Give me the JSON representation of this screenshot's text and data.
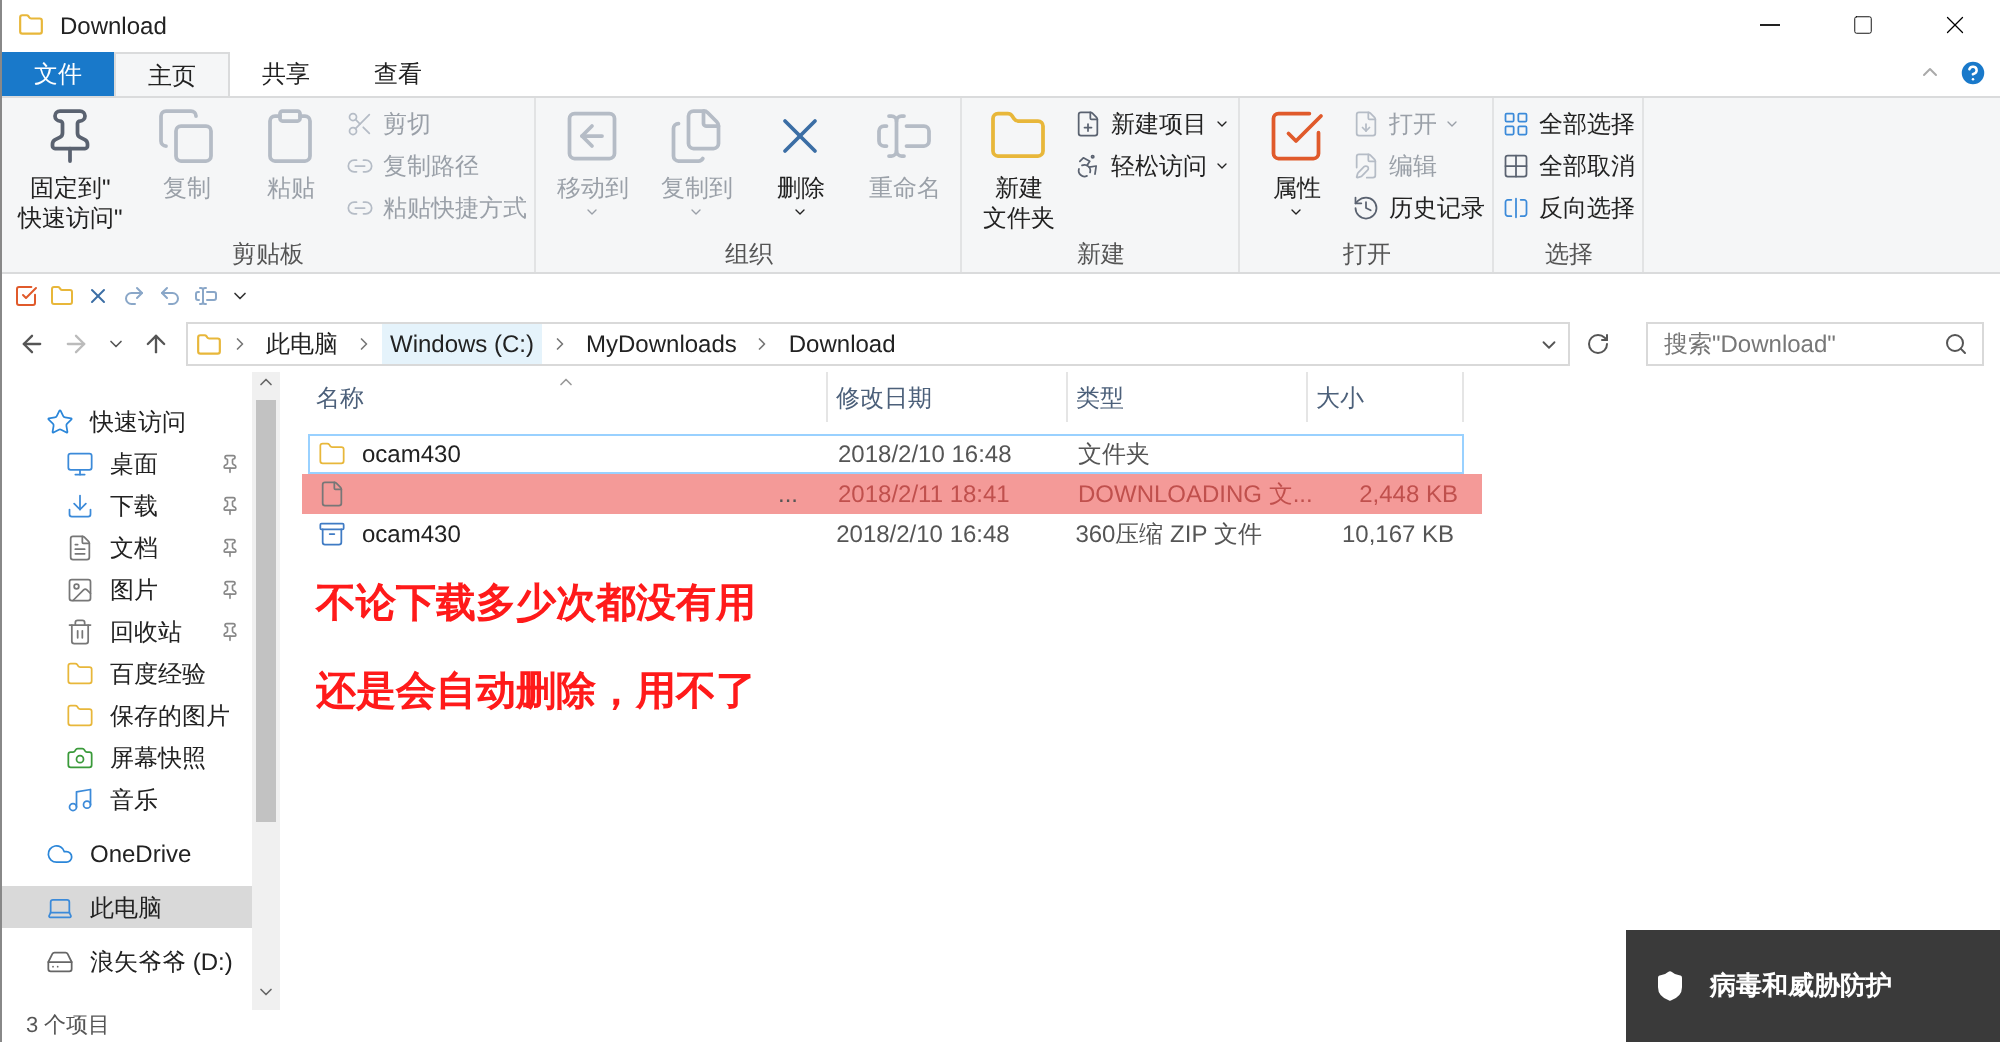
{
  "window": {
    "title": "Download"
  },
  "ribbon_tabs": [
    {
      "label": "文件",
      "kind": "file",
      "selected": false
    },
    {
      "label": "主页",
      "kind": "tab",
      "selected": true
    },
    {
      "label": "共享",
      "kind": "tab",
      "selected": false
    },
    {
      "label": "查看",
      "kind": "tab",
      "selected": false
    }
  ],
  "ribbon_groups": [
    {
      "label": "剪贴板",
      "items": [
        {
          "kind": "large",
          "lines": [
            "固定到\"",
            "快速访问\""
          ],
          "disabled": false,
          "dropdown": false
        },
        {
          "kind": "large",
          "lines": [
            "复制"
          ],
          "disabled": true,
          "dropdown": false
        },
        {
          "kind": "large",
          "lines": [
            "粘贴"
          ],
          "disabled": true,
          "dropdown": false
        },
        {
          "kind": "stack",
          "items": [
            {
              "label": "剪切",
              "disabled": true,
              "dropdown": false
            },
            {
              "label": "复制路径",
              "disabled": true,
              "dropdown": false
            },
            {
              "label": "粘贴快捷方式",
              "disabled": true,
              "dropdown": false
            }
          ]
        }
      ]
    },
    {
      "label": "组织",
      "items": [
        {
          "kind": "large",
          "lines": [
            "移动到"
          ],
          "disabled": true,
          "dropdown": true
        },
        {
          "kind": "large",
          "lines": [
            "复制到"
          ],
          "disabled": true,
          "dropdown": true
        },
        {
          "kind": "large",
          "lines": [
            "删除"
          ],
          "disabled": false,
          "dropdown": true
        },
        {
          "kind": "large",
          "lines": [
            "重命名"
          ],
          "disabled": true,
          "dropdown": false
        }
      ]
    },
    {
      "label": "新建",
      "items": [
        {
          "kind": "large",
          "lines": [
            "新建",
            "文件夹"
          ],
          "disabled": false,
          "dropdown": false
        },
        {
          "kind": "stack",
          "items": [
            {
              "label": "新建项目",
              "disabled": false,
              "dropdown": true
            },
            {
              "label": "轻松访问",
              "disabled": false,
              "dropdown": true
            }
          ]
        }
      ]
    },
    {
      "label": "打开",
      "items": [
        {
          "kind": "large",
          "lines": [
            "属性"
          ],
          "disabled": false,
          "dropdown": true
        },
        {
          "kind": "stack",
          "items": [
            {
              "label": "打开",
              "disabled": true,
              "dropdown": true
            },
            {
              "label": "编辑",
              "disabled": true,
              "dropdown": false
            },
            {
              "label": "历史记录",
              "disabled": false,
              "dropdown": false
            }
          ]
        }
      ]
    },
    {
      "label": "选择",
      "items": [
        {
          "kind": "stack",
          "items": [
            {
              "label": "全部选择",
              "disabled": false,
              "dropdown": false
            },
            {
              "label": "全部取消",
              "disabled": false,
              "dropdown": false
            },
            {
              "label": "反向选择",
              "disabled": false,
              "dropdown": false
            }
          ]
        }
      ]
    }
  ],
  "address_bar": {
    "crumbs": [
      {
        "label": "此电脑",
        "selected": false
      },
      {
        "label": "Windows (C:)",
        "selected": true
      },
      {
        "label": "MyDownloads",
        "selected": false
      },
      {
        "label": "Download",
        "selected": false
      }
    ]
  },
  "search": {
    "placeholder": "搜索\"Download\""
  },
  "sidebar": {
    "items": [
      {
        "label": "快速访问",
        "selected": false,
        "children": [
          {
            "label": "桌面",
            "pinned": true,
            "selected": false
          },
          {
            "label": "下载",
            "pinned": true,
            "selected": false
          },
          {
            "label": "文档",
            "pinned": true,
            "selected": false
          },
          {
            "label": "图片",
            "pinned": true,
            "selected": false
          },
          {
            "label": "回收站",
            "pinned": true,
            "selected": false
          },
          {
            "label": "百度经验",
            "pinned": false,
            "selected": false
          },
          {
            "label": "保存的图片",
            "pinned": false,
            "selected": false
          },
          {
            "label": "屏幕快照",
            "pinned": false,
            "selected": false
          },
          {
            "label": "音乐",
            "pinned": false,
            "selected": false
          }
        ]
      },
      {
        "label": "OneDrive",
        "selected": false
      },
      {
        "label": "此电脑",
        "selected": true
      },
      {
        "label": "浪矢爷爷 (D:)",
        "selected": false
      }
    ]
  },
  "table": {
    "columns": [
      "名称",
      "修改日期",
      "类型",
      "大小"
    ],
    "rows": [
      {
        "kind": "folder",
        "name": "ocam430",
        "date": "2018/2/10 16:48",
        "type": "文件夹",
        "focused": true,
        "highlighted": false
      },
      {
        "kind": "file",
        "name": "...",
        "date": "2018/2/11 18:41",
        "type": "DOWNLOADING 文...",
        "size": "2,448 KB",
        "focused": false,
        "highlighted": true
      },
      {
        "kind": "zip",
        "name": "ocam430",
        "date": "2018/2/10 16:48",
        "type": "360压缩 ZIP 文件",
        "size": "10,167 KB",
        "focused": false,
        "highlighted": false
      }
    ]
  },
  "annotations": [
    "不论下载多少次都没有用",
    "还是会自动删除，用不了"
  ],
  "status_bar": {
    "count": "3 个项目"
  },
  "toast": {
    "title": "病毒和威胁防护"
  }
}
